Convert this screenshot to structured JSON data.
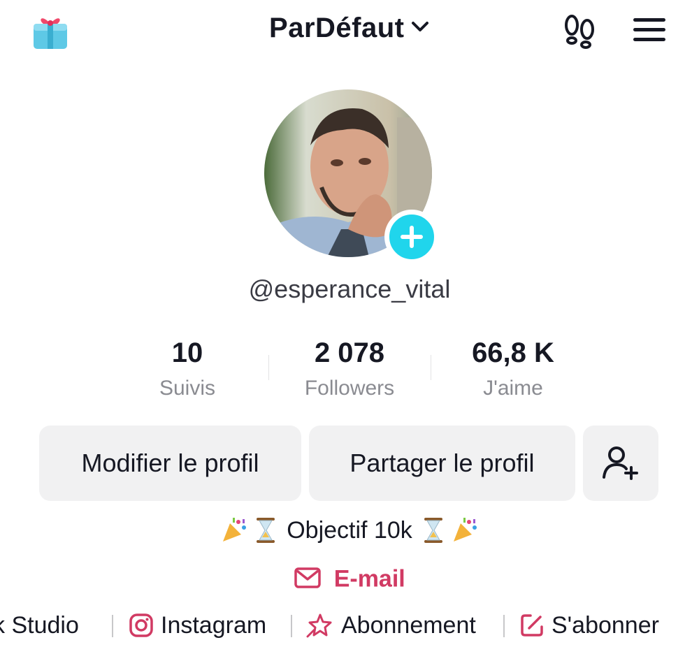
{
  "header": {
    "title": "ParDéfaut",
    "icons": {
      "gift": "gift-icon",
      "footprints": "footprints-icon",
      "menu": "hamburger-menu-icon",
      "dropdown": "chevron-down-icon"
    }
  },
  "profile": {
    "username": "@esperance_vital",
    "avatar_badge_icon": "plus-icon",
    "accent_color": "#20d5ec"
  },
  "stats": [
    {
      "value": "10",
      "label": "Suivis"
    },
    {
      "value": "2 078",
      "label": "Followers"
    },
    {
      "value": "66,8 K",
      "label": "J'aime"
    }
  ],
  "actions": {
    "edit_profile": "Modifier le profil",
    "share_profile": "Partager le profil",
    "add_friend_icon": "add-user-icon"
  },
  "bio": {
    "text": "Objectif 10k",
    "emojis": [
      "party-popper",
      "hourglass",
      "hourglass",
      "party-popper"
    ]
  },
  "email": {
    "label": "E-mail",
    "color": "#d13a63",
    "icon": "envelope-icon"
  },
  "links": [
    {
      "label": "k Studio",
      "icon": ""
    },
    {
      "label": "Instagram",
      "icon": "instagram-icon"
    },
    {
      "label": "Abonnement",
      "icon": "subscription-star-icon"
    },
    {
      "label": "S'abonner",
      "icon": "edit-square-icon"
    }
  ]
}
